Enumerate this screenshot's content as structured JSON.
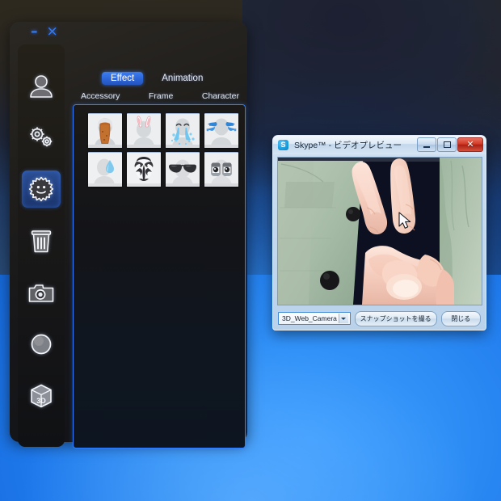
{
  "desktop": {
    "background_color": "#1f7aec",
    "name": "windows-desktop"
  },
  "app_window": {
    "name": "3d-webcam-effects-app",
    "title": "",
    "window_buttons": [
      {
        "name": "minimize",
        "glyph": "–"
      },
      {
        "name": "close",
        "glyph": "×"
      }
    ],
    "accent_color": "#2f7dff",
    "sidebar": {
      "items": [
        {
          "id": "avatar",
          "icon": "person-icon",
          "label": "Avatar",
          "selected": false
        },
        {
          "id": "settings",
          "icon": "gears-icon",
          "label": "Settings",
          "selected": false
        },
        {
          "id": "effects",
          "icon": "sun-face-icon",
          "label": "Effects",
          "selected": true
        },
        {
          "id": "trash",
          "icon": "trash-icon",
          "label": "Delete",
          "selected": false
        },
        {
          "id": "camera",
          "icon": "camera-icon",
          "label": "Capture",
          "selected": false
        },
        {
          "id": "record",
          "icon": "record-icon",
          "label": "Record",
          "selected": false
        },
        {
          "id": "3d",
          "icon": "cube-3d-icon",
          "label": "3D",
          "selected": false
        }
      ]
    },
    "tabs": [
      {
        "label": "Effect",
        "selected": true
      },
      {
        "label": "Animation",
        "selected": false
      }
    ],
    "subtabs": [
      {
        "label": "Accessory",
        "selected": false
      },
      {
        "label": "Frame",
        "selected": false
      },
      {
        "label": "Character",
        "selected": false
      }
    ],
    "thumbnails": [
      {
        "id": "wig-hair",
        "icon": "long-hair-wig-icon",
        "label": "Hair"
      },
      {
        "id": "bunny-ears",
        "icon": "bunny-ears-icon",
        "label": "Bunny Ears"
      },
      {
        "id": "crying-tears",
        "icon": "crying-tears-icon",
        "label": "Tears"
      },
      {
        "id": "blue-splash",
        "icon": "blue-splash-icon",
        "label": "Splash"
      },
      {
        "id": "water-drop",
        "icon": "water-drop-icon",
        "label": "Drop"
      },
      {
        "id": "kabuki-mask",
        "icon": "kabuki-mask-icon",
        "label": "Kabuki Mask"
      },
      {
        "id": "sunglasses",
        "icon": "sunglasses-icon",
        "label": "Sunglasses"
      },
      {
        "id": "cartoon-eyes",
        "icon": "cartoon-eyes-icon",
        "label": "Eyes"
      }
    ]
  },
  "skype_window": {
    "name": "skype-video-preview",
    "title": "Skype™ - ビデオプレビュー",
    "logo_letter": "S",
    "logo_color": "#1ba1e2",
    "window_buttons": [
      {
        "name": "minimize",
        "glyph": ""
      },
      {
        "name": "maximize",
        "glyph": ""
      },
      {
        "name": "close",
        "glyph": "✕",
        "color": "#c8281a"
      }
    ],
    "camera_select": {
      "value": "3D_Web_Camera",
      "placeholder": "3D_Web_Camera"
    },
    "buttons": [
      {
        "name": "take-snapshot",
        "label": "スナップショットを撮る"
      },
      {
        "name": "close",
        "label": "閉じる"
      }
    ],
    "video": {
      "description": "hand-peace-sign-webcam-preview"
    }
  }
}
